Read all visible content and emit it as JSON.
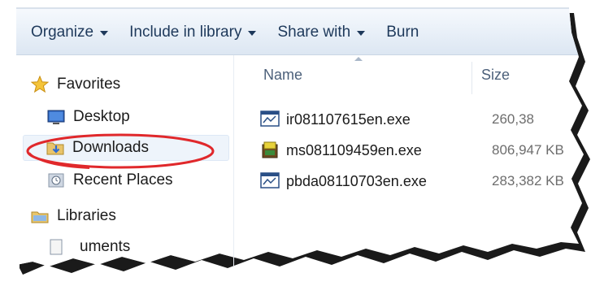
{
  "toolbar": {
    "organize": "Organize",
    "include_in_library": "Include in library",
    "share_with": "Share with",
    "burn": "Burn"
  },
  "nav": {
    "favorites": "Favorites",
    "desktop": "Desktop",
    "downloads": "Downloads",
    "recent_places": "Recent Places",
    "libraries": "Libraries",
    "documents_partial": "uments"
  },
  "columns": {
    "name": "Name",
    "size": "Size"
  },
  "files": [
    {
      "name": "ir081107615en.exe",
      "size": "260,38"
    },
    {
      "name": "ms081109459en.exe",
      "size": "806,947 KB"
    },
    {
      "name": "pbda08110703en.exe",
      "size": "283,382 KB"
    }
  ],
  "icons": {
    "favorites": "star-icon",
    "desktop": "desktop-icon",
    "downloads": "downloads-folder-icon",
    "recent_places": "recent-places-icon",
    "libraries": "libraries-icon",
    "documents": "documents-icon",
    "exe": "exe-file-icon",
    "installer": "installer-icon"
  },
  "colors": {
    "highlight": "#e0282b",
    "toolbar_text": "#1e395b",
    "selection": "#eef4fb"
  }
}
